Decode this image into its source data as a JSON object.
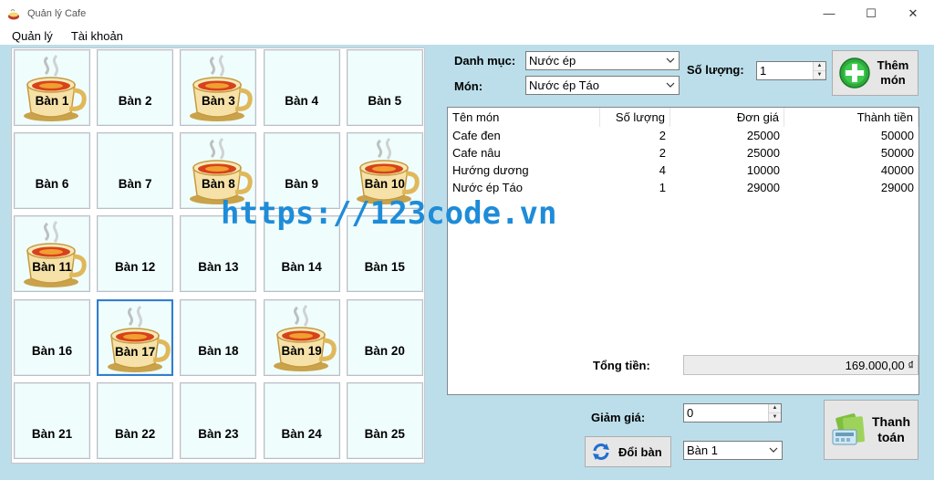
{
  "window": {
    "title": "Quản lý Cafe",
    "minimize": "—",
    "maximize": "☐",
    "close": "✕"
  },
  "menu": {
    "items": [
      "Quản lý",
      "Tài khoản"
    ]
  },
  "tables": [
    {
      "label": "Bàn 1",
      "occupied": true
    },
    {
      "label": "Bàn 2",
      "occupied": false
    },
    {
      "label": "Bàn 3",
      "occupied": true
    },
    {
      "label": "Bàn 4",
      "occupied": false
    },
    {
      "label": "Bàn 5",
      "occupied": false
    },
    {
      "label": "Bàn 6",
      "occupied": false
    },
    {
      "label": "Bàn 7",
      "occupied": false
    },
    {
      "label": "Bàn 8",
      "occupied": true
    },
    {
      "label": "Bàn 9",
      "occupied": false
    },
    {
      "label": "Bàn 10",
      "occupied": true
    },
    {
      "label": "Bàn 11",
      "occupied": true
    },
    {
      "label": "Bàn 12",
      "occupied": false
    },
    {
      "label": "Bàn 13",
      "occupied": false
    },
    {
      "label": "Bàn 14",
      "occupied": false
    },
    {
      "label": "Bàn 15",
      "occupied": false
    },
    {
      "label": "Bàn 16",
      "occupied": false
    },
    {
      "label": "Bàn 17",
      "occupied": true,
      "selected": true
    },
    {
      "label": "Bàn 18",
      "occupied": false
    },
    {
      "label": "Bàn 19",
      "occupied": true
    },
    {
      "label": "Bàn 20",
      "occupied": false
    },
    {
      "label": "Bàn 21",
      "occupied": false
    },
    {
      "label": "Bàn 22",
      "occupied": false
    },
    {
      "label": "Bàn 23",
      "occupied": false
    },
    {
      "label": "Bàn 24",
      "occupied": false
    },
    {
      "label": "Bàn 25",
      "occupied": false
    }
  ],
  "order": {
    "category_label": "Danh mục:",
    "category_value": "Nước ép",
    "item_label": "Món:",
    "item_value": "Nước ép Táo",
    "qty_label": "Số lượng:",
    "qty_value": "1",
    "add_button": "Thêm món"
  },
  "bill": {
    "headers": [
      "Tên món",
      "Số lượng",
      "Đơn giá",
      "Thành tiền"
    ],
    "rows": [
      [
        "Cafe đen",
        "2",
        "25000",
        "50000"
      ],
      [
        "Cafe nâu",
        "2",
        "25000",
        "50000"
      ],
      [
        "Hướng dương",
        "4",
        "10000",
        "40000"
      ],
      [
        "Nước ép Táo",
        "1",
        "29000",
        "29000"
      ]
    ]
  },
  "footer": {
    "total_label": "Tổng tiền:",
    "total_value": "169.000,00 ₫",
    "discount_label": "Giảm giá:",
    "discount_value": "0",
    "switch_button": "Đổi bàn",
    "switch_table_value": "Bàn 1",
    "pay_button": "Thanh toán"
  },
  "watermark": "https://123code.vn",
  "colors": {
    "background": "#bbdeea",
    "table_cell": "#f0fdfd",
    "selected_border": "#2f7fd0",
    "watermark": "#1e8cd8"
  }
}
